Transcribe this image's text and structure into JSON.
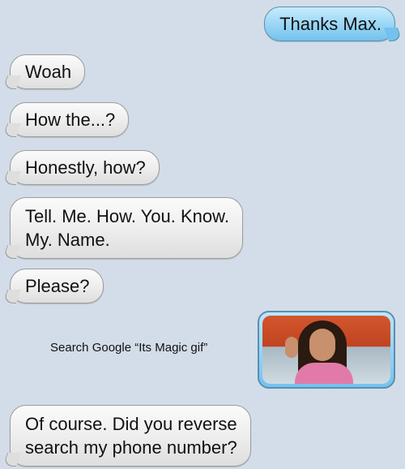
{
  "messages": [
    {
      "from": "me",
      "text": "Thanks Max."
    },
    {
      "from": "them",
      "text": "Woah"
    },
    {
      "from": "them",
      "text": "How the...?"
    },
    {
      "from": "them",
      "text": "Honestly, how?"
    },
    {
      "from": "them",
      "line1": "Tell. Me. How. You. Know.",
      "line2": "My. Name."
    },
    {
      "from": "them",
      "text": "Please?"
    },
    {
      "from": "me",
      "caption": "Search Google “Its Magic gif”",
      "image": "magic-gif"
    },
    {
      "from": "them",
      "line1": "Of course. Did you reverse",
      "line2": "search my phone number?"
    }
  ],
  "colors": {
    "background": "#d3dde9",
    "sent_bubble": "#9bd7f6",
    "received_bubble": "#eeeeee"
  }
}
